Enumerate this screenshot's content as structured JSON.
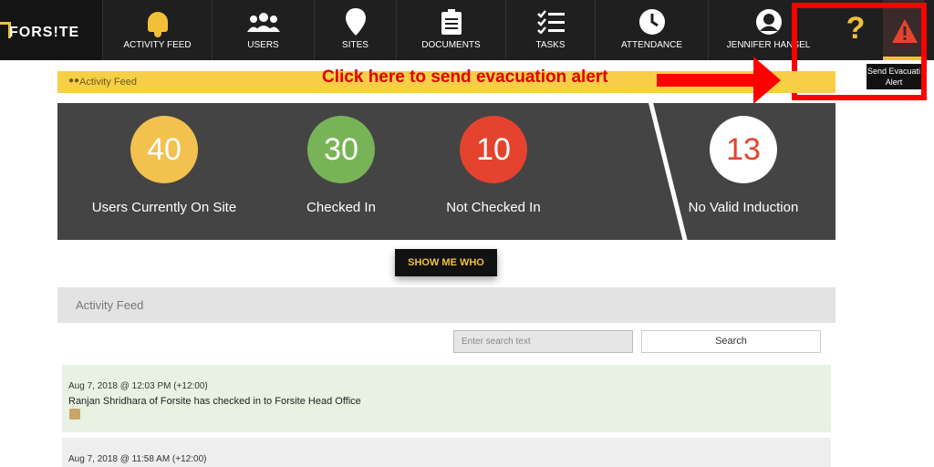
{
  "brand": {
    "logo_text": "FORS!TE",
    "accent": "#f2c037"
  },
  "nav": {
    "items": [
      {
        "label": "ACTIVITY FEED",
        "icon": "bell-icon"
      },
      {
        "label": "USERS",
        "icon": "users-icon"
      },
      {
        "label": "SITES",
        "icon": "map-pin-icon"
      },
      {
        "label": "DOCUMENTS",
        "icon": "clipboard-icon"
      },
      {
        "label": "TASKS",
        "icon": "checklist-icon"
      },
      {
        "label": "ATTENDANCE",
        "icon": "clock-icon"
      },
      {
        "label": "JENNIFER HANSEL",
        "icon": "user-avatar-icon"
      }
    ],
    "help_label": "?",
    "alert_tooltip": "Send Evacuati Alert"
  },
  "callout": {
    "text": "Click here to send evacuation alert",
    "color": "#e00000"
  },
  "activity_bar": {
    "label": "Activity Feed"
  },
  "stats": [
    {
      "value": "40",
      "label": "Users Currently On Site",
      "color": "#f2c14e"
    },
    {
      "value": "30",
      "label": "Checked In",
      "color": "#79b357"
    },
    {
      "value": "10",
      "label": "Not Checked In",
      "color": "#e5432f"
    },
    {
      "value": "13",
      "label": "No Valid Induction",
      "color": "#ffffff",
      "text_color": "#e5432f"
    }
  ],
  "show_me_button": "SHOW ME WHO",
  "feed": {
    "title": "Activity Feed",
    "search_placeholder": "Enter search text",
    "search_button": "Search",
    "entries": [
      {
        "timestamp": "Aug 7, 2018 @ 12:03 PM (+12:00)",
        "message": "Ranjan Shridhara of Forsite has checked in to Forsite Head Office"
      },
      {
        "timestamp": "Aug 7, 2018 @ 11:58 AM (+12:00)",
        "message": ""
      }
    ]
  }
}
